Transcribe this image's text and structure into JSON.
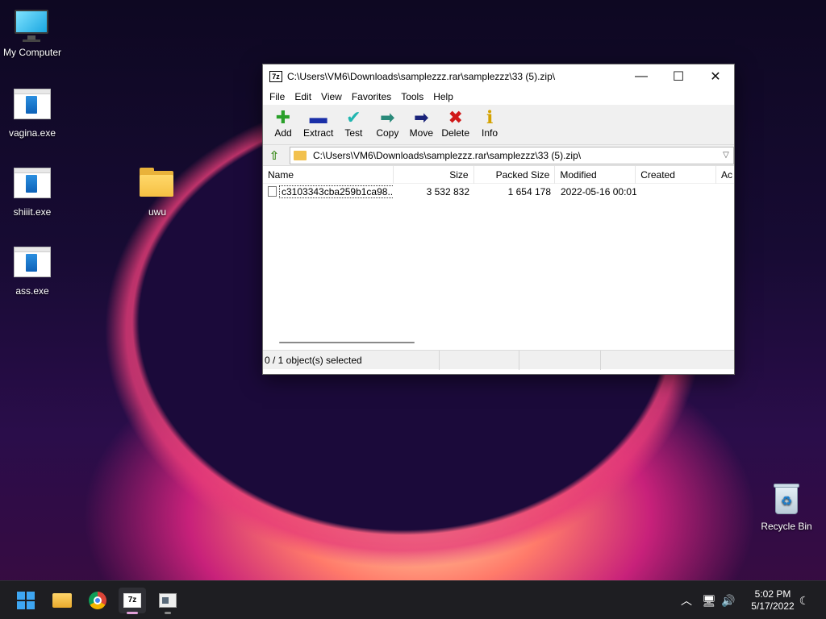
{
  "desktop": {
    "icons": [
      {
        "label": "My Computer",
        "icon": "monitor-icon"
      },
      {
        "label": "vagina.exe",
        "icon": "exe-icon"
      },
      {
        "label": "shiiit.exe",
        "icon": "exe-icon"
      },
      {
        "label": "ass.exe",
        "icon": "exe-icon"
      },
      {
        "label": "uwu",
        "icon": "folder-icon"
      },
      {
        "label": "Recycle Bin",
        "icon": "recycle-bin-icon"
      }
    ]
  },
  "window": {
    "app_icon_text": "7z",
    "title": "C:\\Users\\VM6\\Downloads\\samplezzz.rar\\samplezzz\\33 (5).zip\\",
    "controls": {
      "minimize": "—",
      "maximize": "☐",
      "close": "✕"
    },
    "menu": [
      "File",
      "Edit",
      "View",
      "Favorites",
      "Tools",
      "Help"
    ],
    "toolbar": [
      {
        "label": "Add",
        "icon": "add-icon",
        "glyph": "✚",
        "color": "#2aa02a"
      },
      {
        "label": "Extract",
        "icon": "extract-icon",
        "glyph": "▬",
        "color": "#1a2fa8"
      },
      {
        "label": "Test",
        "icon": "test-icon",
        "glyph": "✔",
        "color": "#21b6b0"
      },
      {
        "label": "Copy",
        "icon": "copy-icon",
        "glyph": "➡",
        "color": "#2a8a7a"
      },
      {
        "label": "Move",
        "icon": "move-icon",
        "glyph": "➡",
        "color": "#1a237a"
      },
      {
        "label": "Delete",
        "icon": "delete-icon",
        "glyph": "✖",
        "color": "#d01818"
      },
      {
        "label": "Info",
        "icon": "info-icon",
        "glyph": "ℹ",
        "color": "#d4a200"
      }
    ],
    "address": "C:\\Users\\VM6\\Downloads\\samplezzz.rar\\samplezzz\\33 (5).zip\\",
    "columns": [
      "Name",
      "Size",
      "Packed Size",
      "Modified",
      "Created",
      "Ac"
    ],
    "rows": [
      {
        "name": "c3103343cba259b1ca98...",
        "size": "3 532 832",
        "packed": "1 654 178",
        "modified": "2022-05-16 00:01",
        "created": "",
        "accessed": ""
      }
    ],
    "status": "0 / 1 object(s) selected"
  },
  "taskbar": {
    "apps": [
      "start-icon",
      "file-explorer-icon",
      "chrome-icon",
      "7zip-icon",
      "app-icon"
    ],
    "tray_glyphs": {
      "chevron": "︿",
      "network": "🖥",
      "volume": "🔊",
      "focus": "☾"
    },
    "time": "5:02 PM",
    "date": "5/17/2022"
  },
  "colors": {
    "accent": "#3ea6f2",
    "taskbar": "#1e1e22"
  }
}
